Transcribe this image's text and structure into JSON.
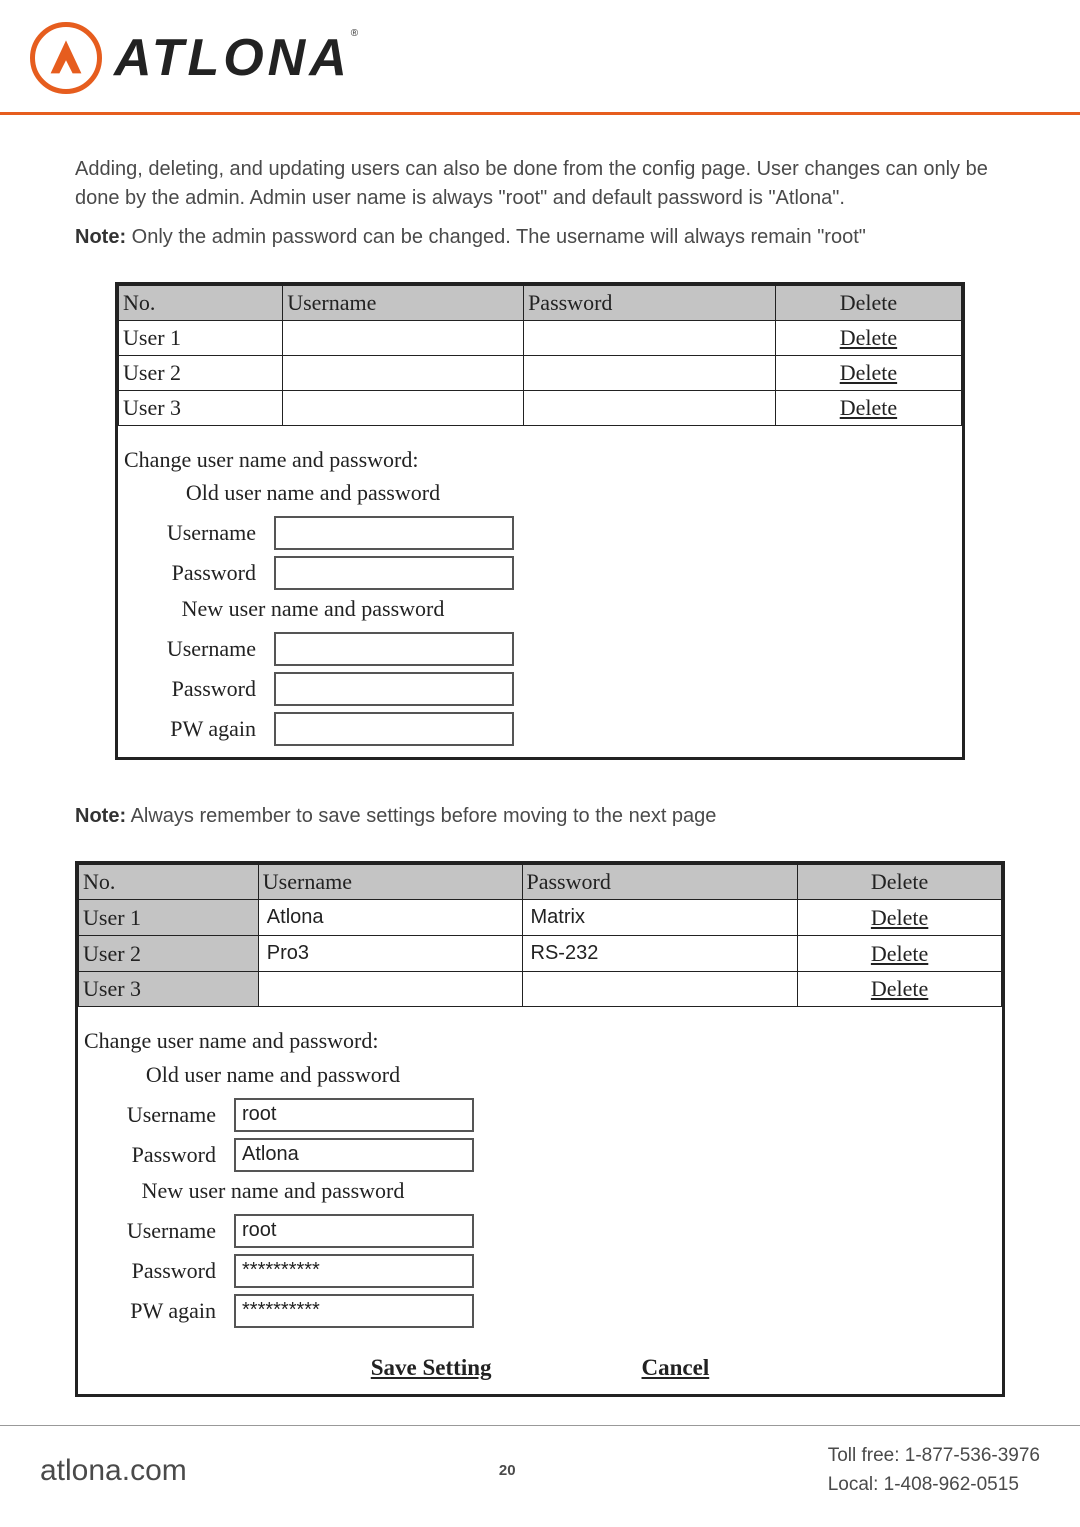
{
  "header": {
    "brand": "ATLONA",
    "reg": "®"
  },
  "intro": {
    "p1": "Adding, deleting, and updating users can also be done from the config page. User changes can only be done by the admin. Admin user name is always \"root\" and default password is \"Atlona\".",
    "note_label": "Note:",
    "note_text": " Only the admin password can be changed. The username will always remain \"root\""
  },
  "panel1": {
    "headers": {
      "no": "No.",
      "username": "Username",
      "password": "Password",
      "delete": "Delete"
    },
    "rows": [
      {
        "no": "User 1",
        "username": "",
        "password": "",
        "delete": "Delete"
      },
      {
        "no": "User 2",
        "username": "",
        "password": "",
        "delete": "Delete"
      },
      {
        "no": "User 3",
        "username": "",
        "password": "",
        "delete": "Delete"
      }
    ],
    "form": {
      "title": "Change user name and password:",
      "old_heading": "Old user name and password",
      "new_heading": "New user name and password",
      "labels": {
        "username": "Username",
        "password": "Password",
        "pw_again": "PW again"
      },
      "old": {
        "username": "",
        "password": ""
      },
      "new": {
        "username": "",
        "password": "",
        "pw_again": ""
      }
    }
  },
  "mid_note": {
    "label": "Note:",
    "text": " Always remember to save settings before moving to the next page"
  },
  "panel2": {
    "headers": {
      "no": "No.",
      "username": "Username",
      "password": "Password",
      "delete": "Delete"
    },
    "rows": [
      {
        "no": "User 1",
        "username": "Atlona",
        "password": "Matrix",
        "delete": "Delete"
      },
      {
        "no": "User 2",
        "username": "Pro3",
        "password": "RS-232",
        "delete": "Delete"
      },
      {
        "no": "User 3",
        "username": "",
        "password": "",
        "delete": "Delete"
      }
    ],
    "form": {
      "title": "Change user name and password:",
      "old_heading": "Old user name and password",
      "new_heading": "New user name and password",
      "labels": {
        "username": "Username",
        "password": "Password",
        "pw_again": "PW again"
      },
      "old": {
        "username": "root",
        "password": "Atlona"
      },
      "new": {
        "username": "root",
        "password": "**********",
        "pw_again": "**********"
      }
    },
    "buttons": {
      "save": "Save Setting",
      "cancel": "Cancel"
    }
  },
  "footer": {
    "site": "atlona.com",
    "page": "20",
    "tollfree": "Toll free: 1-877-536-3976",
    "local": "Local: 1-408-962-0515"
  }
}
